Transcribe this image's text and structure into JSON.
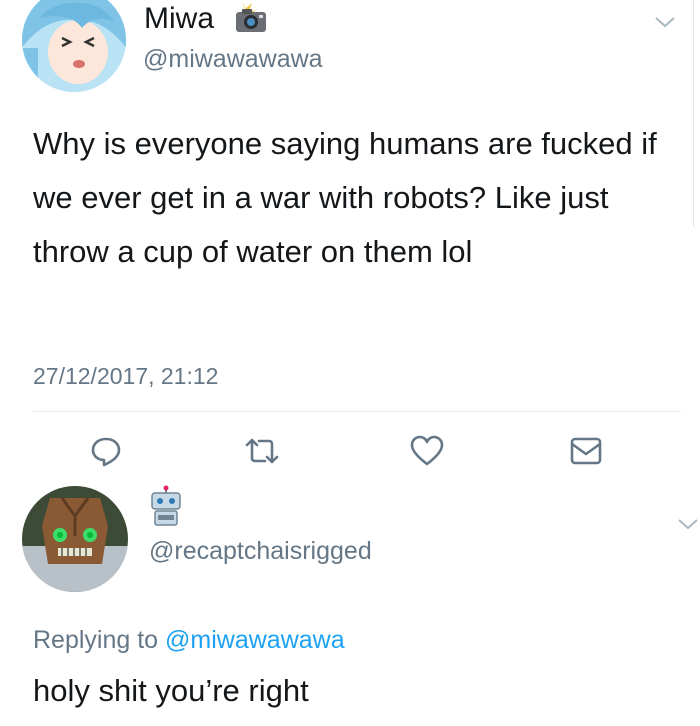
{
  "tweet": {
    "display_name": "Miwa",
    "name_emoji_icon": "camera-flash-icon",
    "handle": "@miwawawawa",
    "text": "Why is everyone saying humans are fucked if we ever get in a war with robots? Like just throw a cup of water on them lol",
    "timestamp": "27/12/2017, 21:12"
  },
  "actions": {
    "reply_icon": "reply-icon",
    "retweet_icon": "retweet-icon",
    "like_icon": "heart-icon",
    "dm_icon": "mail-icon"
  },
  "reply": {
    "name_emoji_icon": "robot-icon",
    "handle": "@recaptchaisrigged",
    "replying_to_label": "Replying to",
    "replying_to_handle": "@miwawawawa",
    "text": "holy shit you’re right"
  },
  "colors": {
    "text": "#14171a",
    "secondary": "#657786",
    "link": "#1da1f2",
    "divider": "#e6ecf0"
  }
}
